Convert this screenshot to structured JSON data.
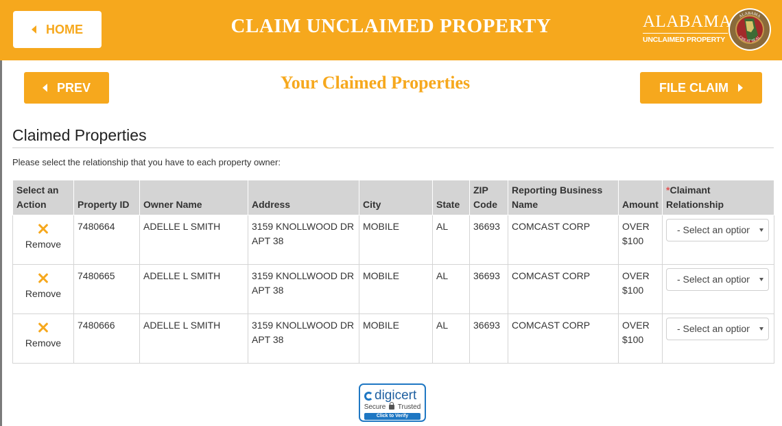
{
  "header": {
    "home_label": "HOME",
    "title": "CLAIM UNCLAIMED PROPERTY",
    "logo_text": "ALABAMA",
    "logo_subtext": "UNCLAIMED PROPERTY",
    "seal_text": "GREAT SEAL",
    "brand_color": "#f6a81d"
  },
  "nav": {
    "prev_label": "PREV",
    "subtitle": "Your Claimed Properties",
    "file_claim_label": "FILE CLAIM"
  },
  "section": {
    "title": "Claimed Properties",
    "instruction": "Please select the relationship that you have to each property owner:"
  },
  "table": {
    "headers": {
      "action": "Select an Action",
      "property_id": "Property ID",
      "owner_name": "Owner Name",
      "address": "Address",
      "city": "City",
      "state": "State",
      "zip": "ZIP Code",
      "business": "Reporting Business Name",
      "amount": "Amount",
      "required_mark": "*",
      "relationship": "Claimant Relationship"
    },
    "rows": [
      {
        "remove_label": "Remove",
        "property_id": "7480664",
        "owner_name": "ADELLE L SMITH",
        "address": "3159 KNOLLWOOD DR APT 38",
        "city": "MOBILE",
        "state": "AL",
        "zip": "36693",
        "business": "COMCAST CORP",
        "amount": "OVER $100",
        "relationship": "- Select an option -"
      },
      {
        "remove_label": "Remove",
        "property_id": "7480665",
        "owner_name": "ADELLE L SMITH",
        "address": "3159 KNOLLWOOD DR APT 38",
        "city": "MOBILE",
        "state": "AL",
        "zip": "36693",
        "business": "COMCAST CORP",
        "amount": "OVER $100",
        "relationship": "- Select an option -"
      },
      {
        "remove_label": "Remove",
        "property_id": "7480666",
        "owner_name": "ADELLE L SMITH",
        "address": "3159 KNOLLWOOD DR APT 38",
        "city": "MOBILE",
        "state": "AL",
        "zip": "36693",
        "business": "COMCAST CORP",
        "amount": "OVER $100",
        "relationship": "- Select an option -"
      }
    ]
  },
  "badge": {
    "brand": "digicert",
    "secure_text": "Secure",
    "trusted_text": "Trusted",
    "verify_text": "Click to Verify"
  }
}
